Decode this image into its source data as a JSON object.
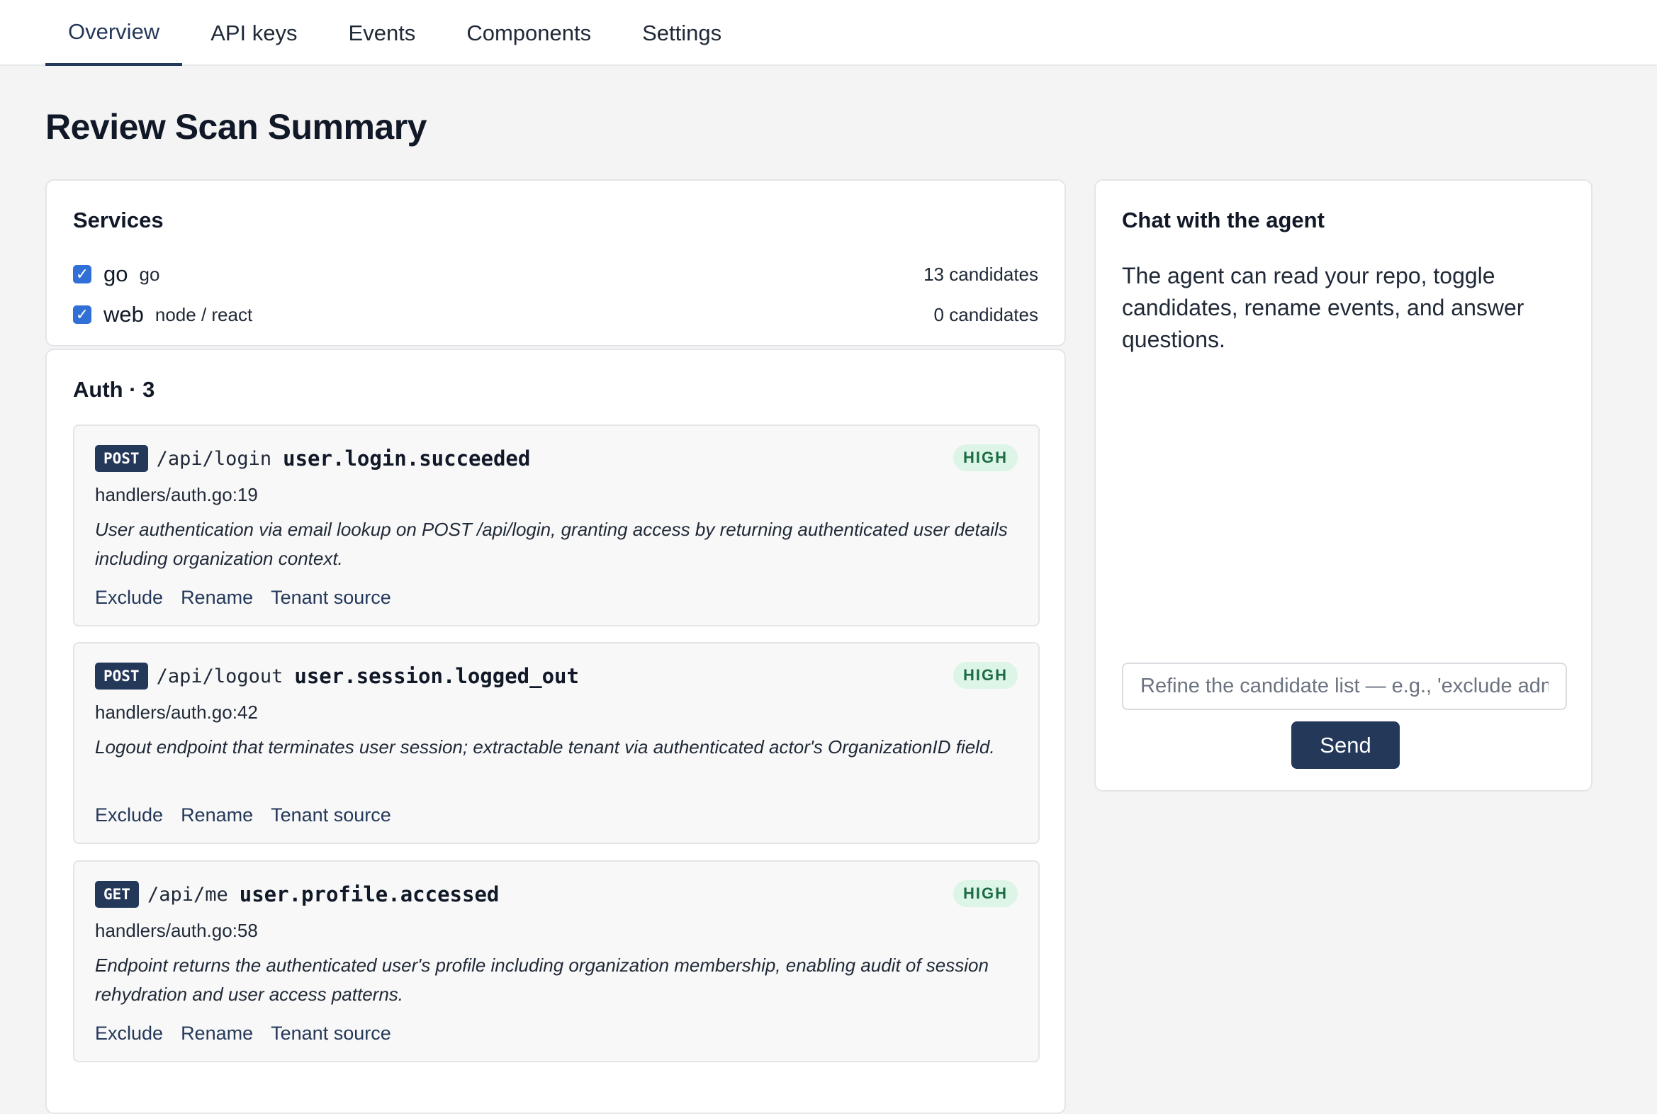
{
  "tabs": [
    {
      "label": "Overview",
      "active": true
    },
    {
      "label": "API keys"
    },
    {
      "label": "Events"
    },
    {
      "label": "Components"
    },
    {
      "label": "Settings"
    }
  ],
  "page": {
    "title": "Review Scan Summary"
  },
  "services": {
    "title": "Services",
    "items": [
      {
        "name": "go",
        "tech": "go",
        "count": "13 candidates",
        "checked": true
      },
      {
        "name": "web",
        "tech": "node / react",
        "count": "0 candidates",
        "checked": true
      }
    ]
  },
  "auth": {
    "title": "Auth · 3",
    "candidates": [
      {
        "method": "POST",
        "path": "/api/login",
        "event": "user.login.succeeded",
        "confidence": "HIGH",
        "file": "handlers/auth.go:19",
        "description": "User authentication via email lookup on POST /api/login, granting access by returning authenticated user details including organization context."
      },
      {
        "method": "POST",
        "path": "/api/logout",
        "event": "user.session.logged_out",
        "confidence": "HIGH",
        "file": "handlers/auth.go:42",
        "description": "Logout endpoint that terminates user session; extractable tenant via authenticated actor's OrganizationID field."
      },
      {
        "method": "GET",
        "path": "/api/me",
        "event": "user.profile.accessed",
        "confidence": "HIGH",
        "file": "handlers/auth.go:58",
        "description": "Endpoint returns the authenticated user's profile including organization membership, enabling audit of session rehydration and user access patterns."
      }
    ],
    "actions": {
      "exclude": "Exclude",
      "rename": "Rename",
      "tenant": "Tenant source"
    }
  },
  "chat": {
    "title": "Chat with the agent",
    "description": "The agent can read your repo, toggle candidates, rename events, and answer questions.",
    "input_placeholder": "Refine the candidate list — e.g., 'exclude admin endpoints'",
    "send_label": "Send"
  },
  "colors": {
    "accent": "#24385a",
    "checkbox": "#2f6fd6",
    "badge_bg": "#dcf5e6",
    "badge_text": "#1b6b43"
  },
  "icons": {
    "checkbox": "checkmark-icon"
  }
}
